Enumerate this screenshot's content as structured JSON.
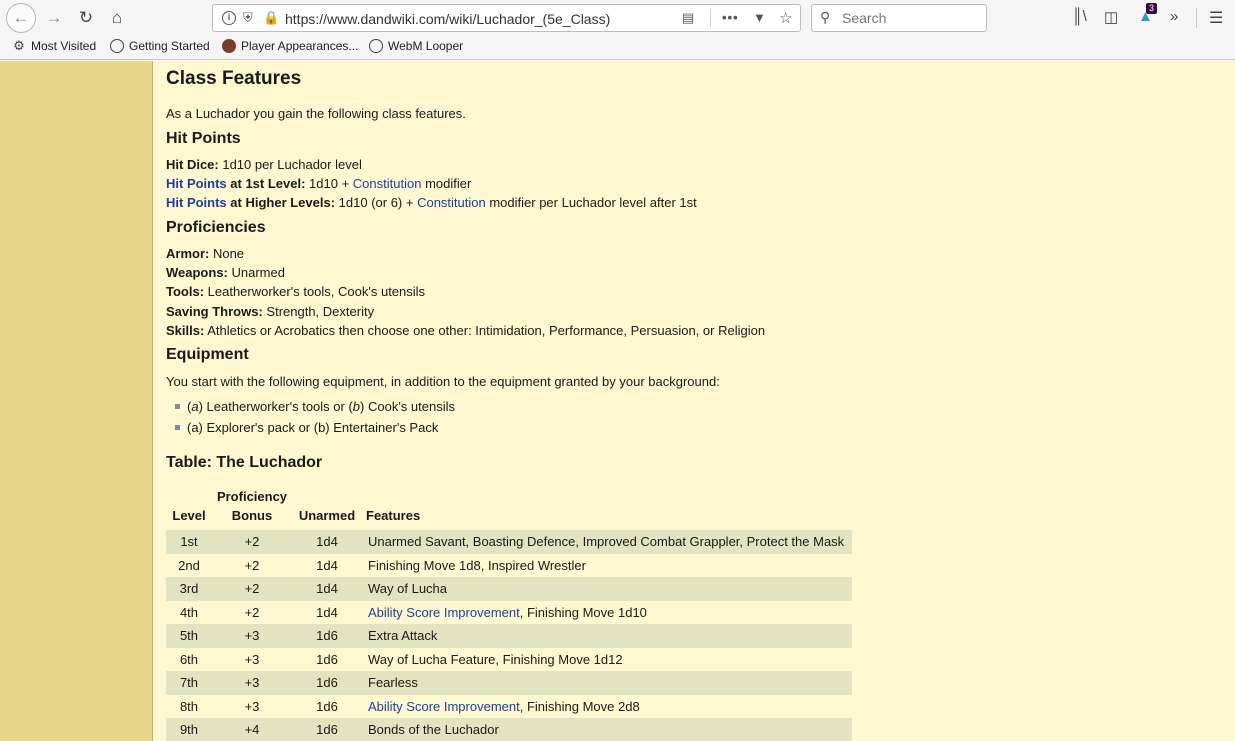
{
  "browser": {
    "url": "https://www.dandwiki.com/wiki/Luchador_(5e_Class)",
    "search_placeholder": "Search",
    "extension_badge": "3",
    "bookmarks": [
      "Most Visited",
      "Getting Started",
      "Player Appearances...",
      "WebM Looper"
    ],
    "icons": [
      "back-arrow-icon",
      "forward-arrow-icon",
      "reload-icon",
      "home-icon",
      "info-icon",
      "shield-icon",
      "lock-icon",
      "reader-view-icon",
      "more-actions-icon",
      "pocket-icon",
      "star-icon",
      "search-icon",
      "library-icon",
      "sidebar-icon",
      "extension-icon",
      "overflow-icon",
      "hamburger-menu-icon"
    ]
  },
  "page": {
    "title": "Class Features",
    "intro": "As a Luchador you gain the following class features.",
    "hit_points": {
      "heading": "Hit Points",
      "hit_dice_label": "Hit Dice:",
      "hit_dice_value": " 1d10 per Luchador level",
      "first_link": "Hit Points",
      "first_label": " at 1st Level:",
      "first_value_a": " 1d10 + ",
      "first_con_link": "Constitution",
      "first_value_b": " modifier",
      "higher_link": "Hit Points",
      "higher_label": " at Higher Levels:",
      "higher_value_a": " 1d10 (or 6) + ",
      "higher_con_link": "Constitution",
      "higher_value_b": " modifier per Luchador level after 1st"
    },
    "proficiencies": {
      "heading": "Proficiencies",
      "armor_label": "Armor:",
      "armor_value": " None",
      "weapons_label": "Weapons:",
      "weapons_value": " Unarmed",
      "tools_label": "Tools:",
      "tools_value": " Leatherworker's tools, Cook's utensils",
      "saves_label": "Saving Throws:",
      "saves_value": " Strength, Dexterity",
      "skills_label": "Skills:",
      "skills_value": " Athletics or Acrobatics then choose one other: Intimidation, Performance, Persuasion, or Religion"
    },
    "equipment": {
      "heading": "Equipment",
      "intro": "You start with the following equipment, in addition to the equipment granted by your background:",
      "item1_a": "(",
      "item1_a_letter": "a",
      "item1_b": ") Leatherworker's tools or (",
      "item1_b_letter": "b",
      "item1_c": ") Cook's utensils",
      "item2": "(a) Explorer's pack or (b) Entertainer's Pack"
    },
    "table": {
      "heading": "Table: The Luchador",
      "headers": [
        "Level",
        "Proficiency",
        "Bonus",
        "Unarmed",
        "Features"
      ],
      "rows": [
        {
          "level": "1st",
          "bonus": "+2",
          "unarmed": "1d4",
          "link": "",
          "features": "Unarmed Savant, Boasting Defence, Improved Combat Grappler, Protect the Mask"
        },
        {
          "level": "2nd",
          "bonus": "+2",
          "unarmed": "1d4",
          "link": "",
          "features": "Finishing Move 1d8, Inspired Wrestler"
        },
        {
          "level": "3rd",
          "bonus": "+2",
          "unarmed": "1d4",
          "link": "",
          "features": "Way of Lucha"
        },
        {
          "level": "4th",
          "bonus": "+2",
          "unarmed": "1d4",
          "link": "Ability Score Improvement",
          "features": ", Finishing Move 1d10"
        },
        {
          "level": "5th",
          "bonus": "+3",
          "unarmed": "1d6",
          "link": "",
          "features": "Extra Attack"
        },
        {
          "level": "6th",
          "bonus": "+3",
          "unarmed": "1d6",
          "link": "",
          "features": "Way of Lucha Feature, Finishing Move 1d12"
        },
        {
          "level": "7th",
          "bonus": "+3",
          "unarmed": "1d6",
          "link": "",
          "features": "Fearless"
        },
        {
          "level": "8th",
          "bonus": "+3",
          "unarmed": "1d6",
          "link": "Ability Score Improvement",
          "features": ", Finishing Move 2d8"
        },
        {
          "level": "9th",
          "bonus": "+4",
          "unarmed": "1d6",
          "link": "",
          "features": "Bonds of the Luchador"
        }
      ]
    }
  },
  "colors": {
    "page_bg": "#fdf8cf",
    "rail_bg": "#e6d58b",
    "link": "#1d3fa8",
    "row_alt": "#e1e4c1"
  }
}
